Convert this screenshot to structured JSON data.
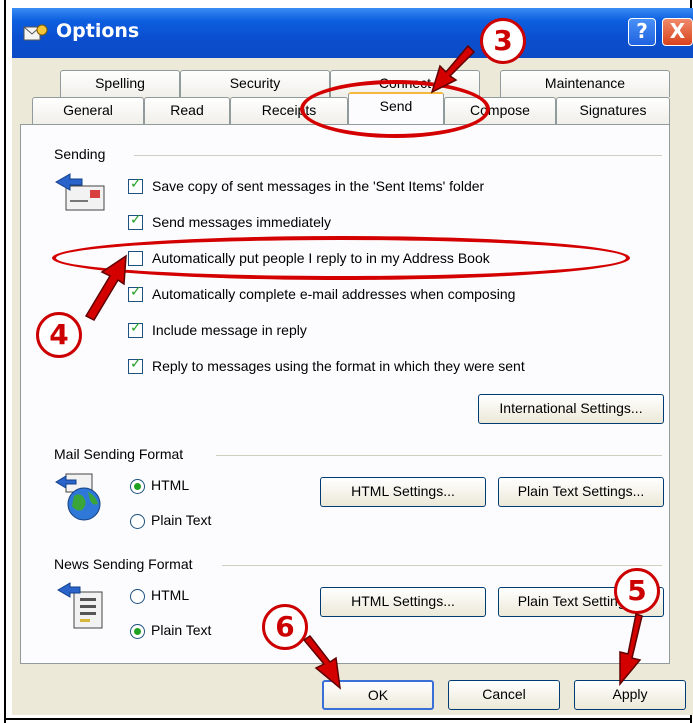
{
  "window": {
    "title": "Options"
  },
  "title_buttons": {
    "help": "?",
    "close": "X"
  },
  "tabs_row1": [
    "Spelling",
    "Security",
    "Connect",
    "Maintenance"
  ],
  "tabs_row2": [
    "General",
    "Read",
    "Receipts",
    "Send",
    "Compose",
    "Signatures"
  ],
  "active_tab": "Send",
  "sending": {
    "header": "Sending",
    "options": [
      {
        "label": "Save copy of sent messages in the 'Sent Items' folder",
        "checked": true
      },
      {
        "label": "Send messages immediately",
        "checked": true
      },
      {
        "label": "Automatically put people I reply to in my Address Book",
        "checked": false
      },
      {
        "label": "Automatically complete e-mail addresses when composing",
        "checked": true
      },
      {
        "label": "Include message in reply",
        "checked": true
      },
      {
        "label": "Reply to messages using the format in which they were sent",
        "checked": true
      }
    ],
    "intl_button": "International Settings..."
  },
  "mail_format": {
    "header": "Mail Sending Format",
    "html_label": "HTML",
    "plain_label": "Plain Text",
    "selected": "HTML",
    "html_settings": "HTML Settings...",
    "plain_settings": "Plain Text Settings..."
  },
  "news_format": {
    "header": "News Sending Format",
    "html_label": "HTML",
    "plain_label": "Plain Text",
    "selected": "Plain Text",
    "html_settings": "HTML Settings...",
    "plain_settings": "Plain Text Settings..."
  },
  "footer": {
    "ok": "OK",
    "cancel": "Cancel",
    "apply": "Apply"
  },
  "callouts": [
    "3",
    "4",
    "5",
    "6"
  ],
  "colors": {
    "annotation": "#cc0000",
    "titlebar": "#0a4fd0",
    "dialog": "#ece9d8",
    "check": "#21a121"
  }
}
